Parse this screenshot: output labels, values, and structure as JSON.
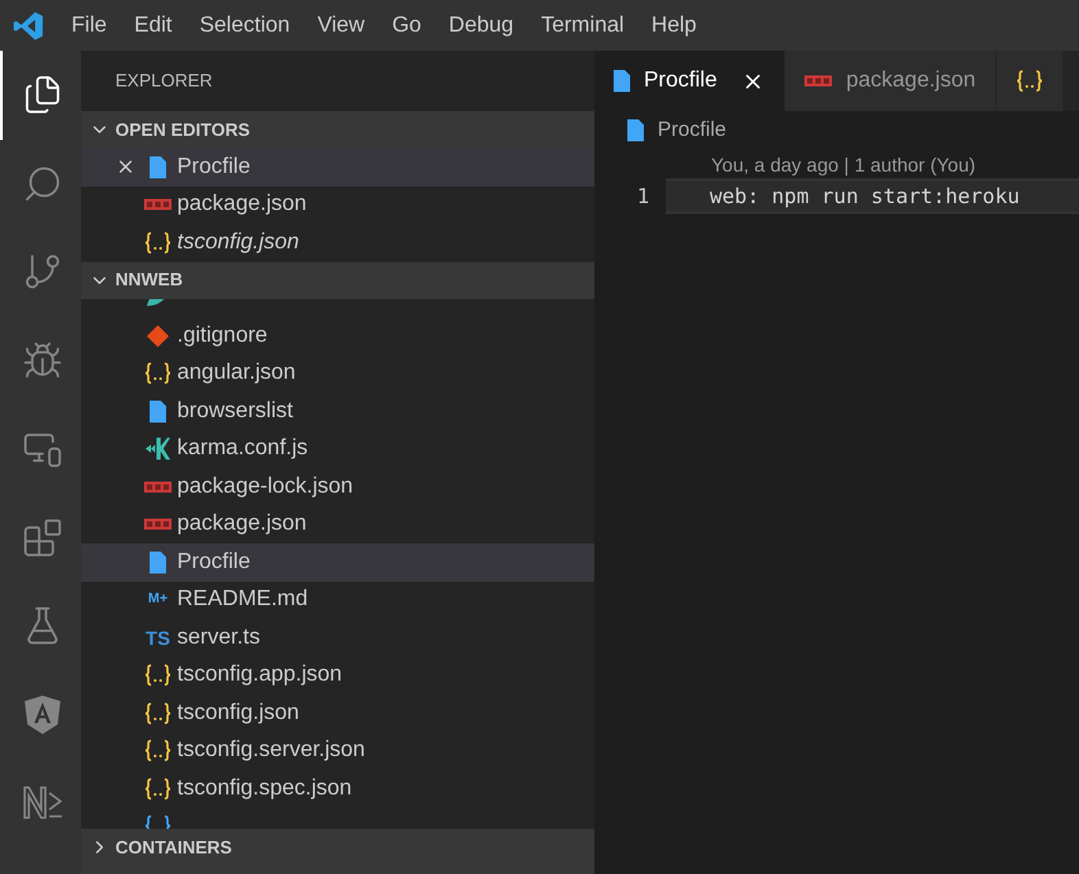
{
  "menu_bar": {
    "items": [
      "File",
      "Edit",
      "Selection",
      "View",
      "Go",
      "Debug",
      "Terminal",
      "Help"
    ]
  },
  "activity_bar": [
    {
      "kind": "files",
      "selected": true
    },
    {
      "kind": "search",
      "selected": false
    },
    {
      "kind": "source-control",
      "selected": false
    },
    {
      "kind": "debug",
      "selected": false
    },
    {
      "kind": "remote",
      "selected": false
    },
    {
      "kind": "extensions",
      "selected": false
    },
    {
      "kind": "testing",
      "selected": false
    },
    {
      "kind": "angular",
      "selected": false
    },
    {
      "kind": "nx",
      "selected": false
    }
  ],
  "sidebar": {
    "title": "EXPLORER",
    "open_editors": {
      "title": "OPEN EDITORS",
      "expanded": true,
      "items": [
        {
          "name": "Procfile",
          "kind": "file",
          "selected": true,
          "preview": false
        },
        {
          "name": "package.json",
          "kind": "npm",
          "selected": false,
          "preview": false
        },
        {
          "name": "tsconfig.json",
          "kind": "json",
          "selected": false,
          "preview": true
        }
      ]
    },
    "project": {
      "title": "NNWEB",
      "expanded": true,
      "items": [
        {
          "kind": "editorconfig",
          "selected": false
        },
        {
          "name": ".gitignore",
          "kind": "git",
          "selected": false
        },
        {
          "name": "angular.json",
          "kind": "json",
          "selected": false
        },
        {
          "name": "browserslist",
          "kind": "file",
          "selected": false
        },
        {
          "name": "karma.conf.js",
          "kind": "karma",
          "selected": false
        },
        {
          "name": "package-lock.json",
          "kind": "npm",
          "selected": false
        },
        {
          "name": "package.json",
          "kind": "npm",
          "selected": false
        },
        {
          "name": "Procfile",
          "kind": "file",
          "selected": true
        },
        {
          "name": "README.md",
          "kind": "markdown",
          "icon_label": "M+",
          "selected": false
        },
        {
          "name": "server.ts",
          "kind": "ts",
          "icon_label": "TS",
          "selected": false
        },
        {
          "name": "tsconfig.app.json",
          "kind": "json",
          "selected": false
        },
        {
          "name": "tsconfig.json",
          "kind": "json",
          "selected": false
        },
        {
          "name": "tsconfig.server.json",
          "kind": "json",
          "selected": false
        },
        {
          "name": "tsconfig.spec.json",
          "kind": "json",
          "selected": false
        },
        {
          "kind": "tslint",
          "selected": false
        }
      ]
    },
    "containers": {
      "title": "CONTAINERS",
      "expanded": false
    }
  },
  "tabs": [
    {
      "label": "Procfile",
      "kind": "file",
      "selected": true
    },
    {
      "label": "package.json",
      "kind": "npm",
      "selected": false
    },
    {
      "kind": "json",
      "selected": false
    }
  ],
  "breadcrumb": {
    "label": "Procfile",
    "kind": "file"
  },
  "editor": {
    "codelens": "You, a day ago | 1 author (You)",
    "lines": [
      {
        "number": "1",
        "text": "web: npm run start:heroku",
        "current": true
      }
    ]
  }
}
